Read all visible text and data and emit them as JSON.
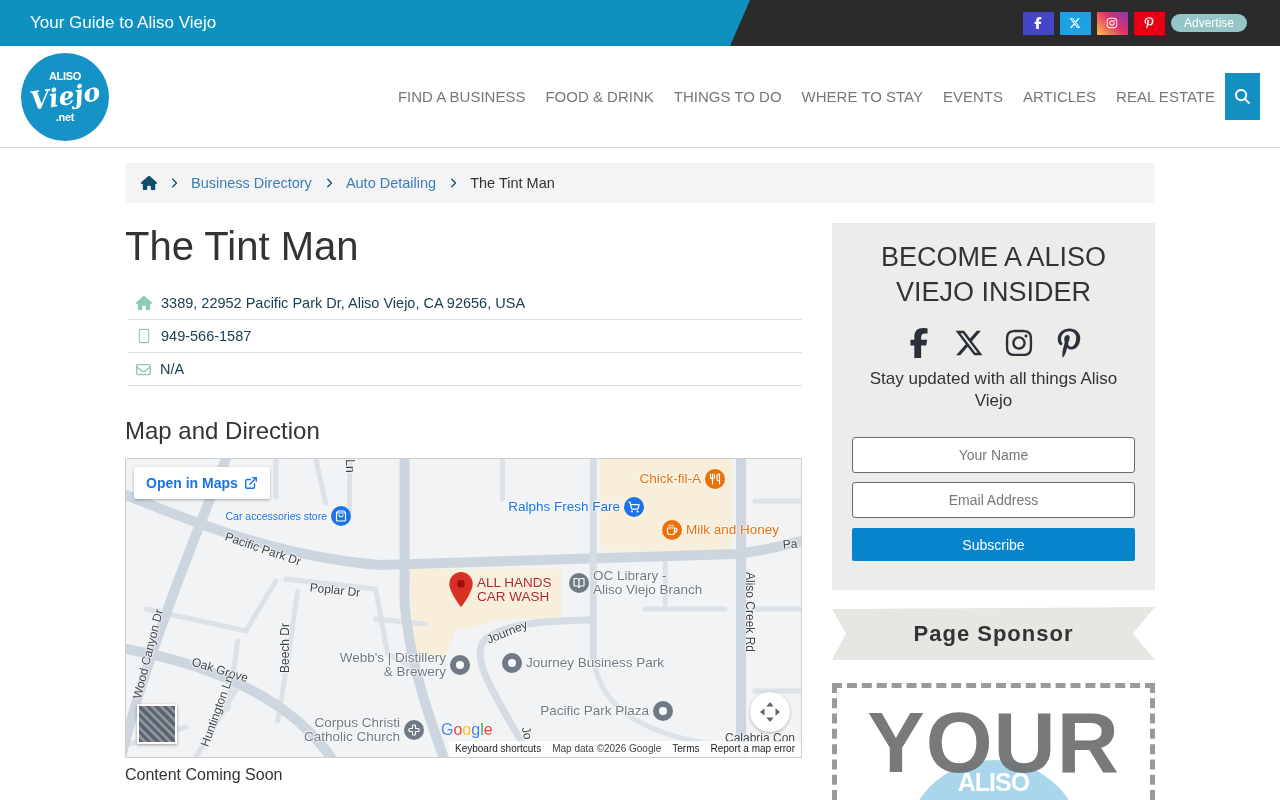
{
  "top_bar": {
    "tagline": "Your Guide to Aliso Viejo",
    "social": [
      {
        "kind": "facebook"
      },
      {
        "kind": "x"
      },
      {
        "kind": "instagram"
      },
      {
        "kind": "pinterest"
      }
    ],
    "advertise": "Advertise"
  },
  "header": {
    "logo": {
      "top": "ALISO",
      "script": "Viejo",
      "bottom": ".net"
    },
    "nav": [
      {
        "label": "FIND A BUSINESS"
      },
      {
        "label": "FOOD & DRINK"
      },
      {
        "label": "THINGS TO DO"
      },
      {
        "label": "WHERE TO STAY"
      },
      {
        "label": "EVENTS"
      },
      {
        "label": "ARTICLES"
      },
      {
        "label": "REAL ESTATE"
      }
    ]
  },
  "breadcrumb": [
    {
      "label": "Business Directory",
      "kind": "link"
    },
    {
      "label": "Auto Detailing",
      "kind": "link"
    },
    {
      "label": "The Tint Man",
      "kind": "current"
    }
  ],
  "business": {
    "name": "The Tint Man",
    "contacts": [
      {
        "kind": "address",
        "text": "3389, 22952 Pacific Park Dr, Aliso Viejo, CA 92656, USA"
      },
      {
        "kind": "phone",
        "text": "949-566-1587"
      },
      {
        "kind": "email",
        "text": "N/A"
      }
    ]
  },
  "map_section": {
    "heading": "Map and Direction",
    "map": {
      "open_button": "Open in Maps",
      "labels": [
        {
          "text": "Ln"
        },
        {
          "text": "Pacific Park Dr"
        },
        {
          "text": "Pa"
        },
        {
          "text": "Poplar Dr"
        },
        {
          "text": "Aliso Creek Rd"
        },
        {
          "text": "Journey"
        },
        {
          "text": "Wood Canyon Dr"
        },
        {
          "text": "Oak Grove"
        },
        {
          "text": "Beech Dr"
        },
        {
          "text": "Huntington Ln"
        },
        {
          "text": "Jo"
        },
        {
          "text": "Calabria Con"
        }
      ],
      "places": [
        {
          "name": "Chick-fil-A",
          "kind": "restaurant",
          "color": "#e8710a"
        },
        {
          "name": "Ralphs Fresh Fare",
          "kind": "grocery",
          "color": "#1a73e8"
        },
        {
          "name": "Milk and Honey",
          "kind": "cafe",
          "color": "#e8710a"
        },
        {
          "name": "Car accessories store",
          "kind": "store",
          "color": "#1a73e8"
        },
        {
          "name": "OC Library -\nAliso Viejo Branch",
          "kind": "library",
          "color": "#707a86"
        },
        {
          "name": "Webb's | Distillery\n& Brewery",
          "kind": "place",
          "color": "#707a86"
        },
        {
          "name": "Journey Business Park",
          "kind": "place",
          "color": "#707a86"
        },
        {
          "name": "Corpus Christi\nCatholic Church",
          "kind": "church",
          "color": "#707a86"
        },
        {
          "name": "Pacific Park Plaza",
          "kind": "place",
          "color": "#707a86"
        }
      ],
      "marker": {
        "label": "ALL HANDS\nCAR WASH"
      },
      "logo": "Google",
      "attribution": [
        {
          "text": "Keyboard shortcuts",
          "kind": "link"
        },
        {
          "text": "Map data ©2026 Google",
          "kind": "text"
        },
        {
          "text": "Terms",
          "kind": "link"
        },
        {
          "text": "Report a map error",
          "kind": "link"
        }
      ]
    },
    "note": "Content Coming Soon"
  },
  "sidebar": {
    "newsletter": {
      "title": "BECOME A ALISO VIEJO INSIDER",
      "social": [
        {
          "kind": "facebook"
        },
        {
          "kind": "x"
        },
        {
          "kind": "instagram"
        },
        {
          "kind": "pinterest"
        }
      ],
      "text": "Stay updated with all things Aliso Viejo",
      "fields": [
        {
          "placeholder": "Your Name"
        },
        {
          "placeholder": "Email Address"
        }
      ],
      "button": "Subscribe"
    },
    "sponsor": {
      "title": "Page Sponsor",
      "ad": {
        "headline": "YOUR",
        "badge": "ALISO"
      }
    }
  }
}
